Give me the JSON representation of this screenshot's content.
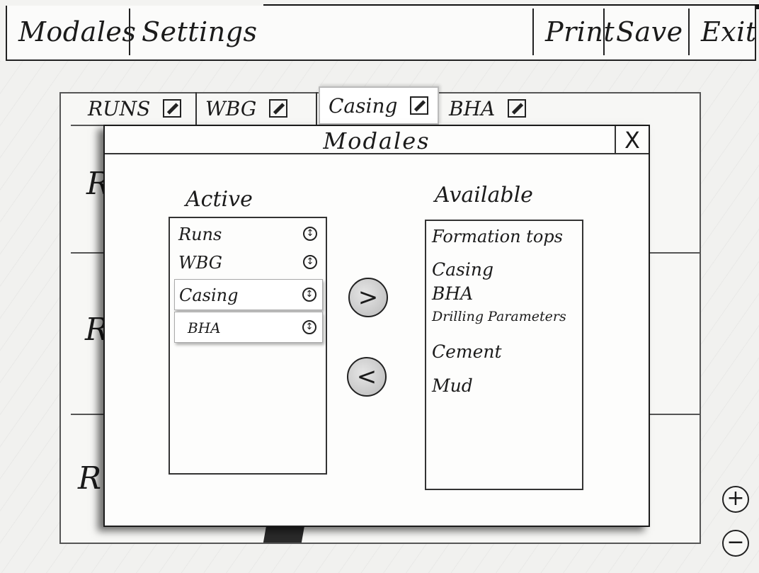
{
  "menubar": {
    "modules": "Modales",
    "settings": "Settings",
    "print": "Print",
    "save": "Save",
    "exit": "Exit"
  },
  "background_tabs": [
    {
      "label": "RUNS",
      "icon": "pencil-icon"
    },
    {
      "label": "WBG",
      "icon": "pencil-icon"
    },
    {
      "label": "Casing",
      "icon": "pencil-icon"
    },
    {
      "label": "BHA",
      "icon": "pencil-icon"
    }
  ],
  "background_rows": [
    "R",
    "R",
    "R"
  ],
  "modal": {
    "title": "Modales",
    "close": "X",
    "active_heading": "Active",
    "available_heading": "Available",
    "active_items": [
      "Runs",
      "WBG",
      "Casing",
      "BHA"
    ],
    "available_items": [
      "Formation tops",
      "Casing",
      "BHA",
      "Drilling Parameters",
      "Cement",
      "Mud"
    ],
    "move_right": ">",
    "move_left": "<"
  },
  "zoom": {
    "in": "+",
    "out": "−"
  }
}
